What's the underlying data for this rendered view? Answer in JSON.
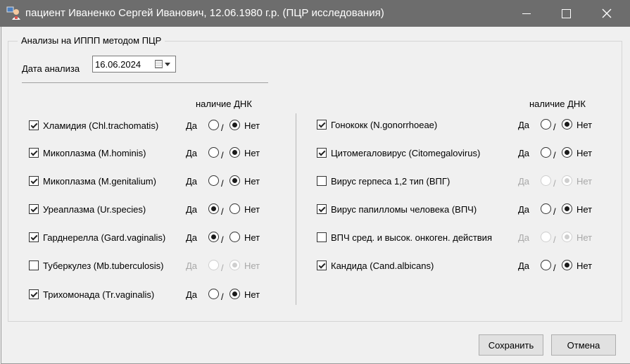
{
  "window": {
    "title": "пациент Иваненко Сергей Иванович, 12.06.1980 г.р. (ПЦР исследования)"
  },
  "group": {
    "title": "Анализы на ИППП методом ПЦР"
  },
  "date": {
    "label": "Дата анализа",
    "value": "16.06.2024"
  },
  "dna_header": "наличие ДНК",
  "yes_label": "Да",
  "no_label": "Нет",
  "slash": "/",
  "left_tests": [
    {
      "label": "Хламидия (Chl.trachomatis)",
      "checked": true,
      "result": "no",
      "enabled": true
    },
    {
      "label": "Микоплазма (M.hominis)",
      "checked": true,
      "result": "no",
      "enabled": true
    },
    {
      "label": "Микоплазма (M.genitalium)",
      "checked": true,
      "result": "no",
      "enabled": true
    },
    {
      "label": "Уреаплазма (Ur.species)",
      "checked": true,
      "result": "yes",
      "enabled": true
    },
    {
      "label": "Гарднерелла (Gard.vaginalis)",
      "checked": true,
      "result": "yes",
      "enabled": true
    },
    {
      "label": "Туберкулез (Mb.tuberculosis)",
      "checked": false,
      "result": "no",
      "enabled": false
    },
    {
      "label": "Трихомонада (Tr.vaginalis)",
      "checked": true,
      "result": "no",
      "enabled": true
    }
  ],
  "right_tests": [
    {
      "label": "Гонококк (N.gonorrhoeae)",
      "checked": true,
      "result": "no",
      "enabled": true
    },
    {
      "label": "Цитомегаловирус (Citomegalovirus)",
      "checked": true,
      "result": "no",
      "enabled": true
    },
    {
      "label": "Вирус герпеса 1,2 тип (ВПГ)",
      "checked": false,
      "result": "no",
      "enabled": false
    },
    {
      "label": "Вирус папилломы человека (ВПЧ)",
      "checked": true,
      "result": "no",
      "enabled": true
    },
    {
      "label": "ВПЧ сред. и высок. онкоген. действия",
      "checked": false,
      "result": "no",
      "enabled": false
    },
    {
      "label": "Кандида (Cand.albicans)",
      "checked": true,
      "result": "no",
      "enabled": true
    }
  ],
  "buttons": {
    "save": "Сохранить",
    "cancel": "Отмена"
  }
}
